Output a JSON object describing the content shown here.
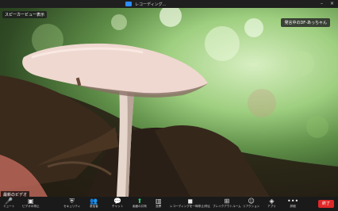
{
  "window": {
    "title": "レコーディング..."
  },
  "speaker_view_label": "スピーカービュー表示",
  "participant_name_top": "発言中のDF-あっちゃん",
  "self_name_label": "最新のビデオ",
  "toolbar": {
    "items": [
      {
        "icon": "mic-icon",
        "glyph": "🎤",
        "label": "ミュート"
      },
      {
        "icon": "video-icon",
        "glyph": "▣",
        "label": "ビデオの停止"
      },
      {
        "icon": "security-icon",
        "glyph": "⛨",
        "label": "セキュリティ"
      },
      {
        "icon": "participants-icon",
        "glyph": "👥",
        "label": "参加者"
      },
      {
        "icon": "chat-icon",
        "glyph": "💬",
        "label": "チャット"
      },
      {
        "icon": "share-screen-icon",
        "glyph": "⬆",
        "label": "画面の共有"
      },
      {
        "icon": "poll-icon",
        "glyph": "▥",
        "label": "投票"
      },
      {
        "icon": "record-icon",
        "glyph": "◼",
        "label": "レコーディングを一時停止/停止"
      },
      {
        "icon": "breakout-icon",
        "glyph": "⊞",
        "label": "ブレイクアウトルーム"
      },
      {
        "icon": "reaction-icon",
        "glyph": "☺",
        "label": "リアクション"
      },
      {
        "icon": "apps-icon",
        "glyph": "◈",
        "label": "アプリ"
      },
      {
        "icon": "more-icon",
        "glyph": "•••",
        "label": "詳細"
      }
    ],
    "end_label": "終了"
  }
}
